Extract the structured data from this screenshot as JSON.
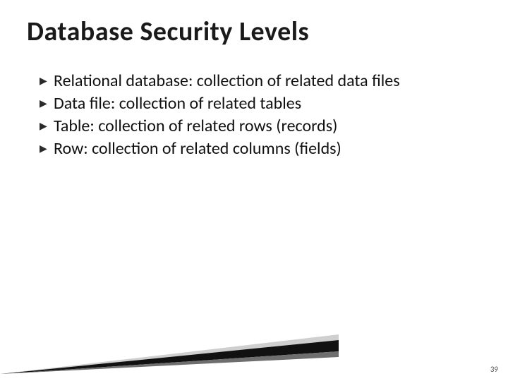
{
  "title": "Database Security Levels",
  "bullets": [
    "Relational database: collection of related data files",
    "Data file: collection of related tables",
    "Table: collection of related rows (records)",
    "Row: collection of related columns (fields)"
  ],
  "page_number": "39",
  "accent": {
    "light": "#cfcfcf",
    "mid": "#6e6e6e",
    "dark": "#111111"
  }
}
